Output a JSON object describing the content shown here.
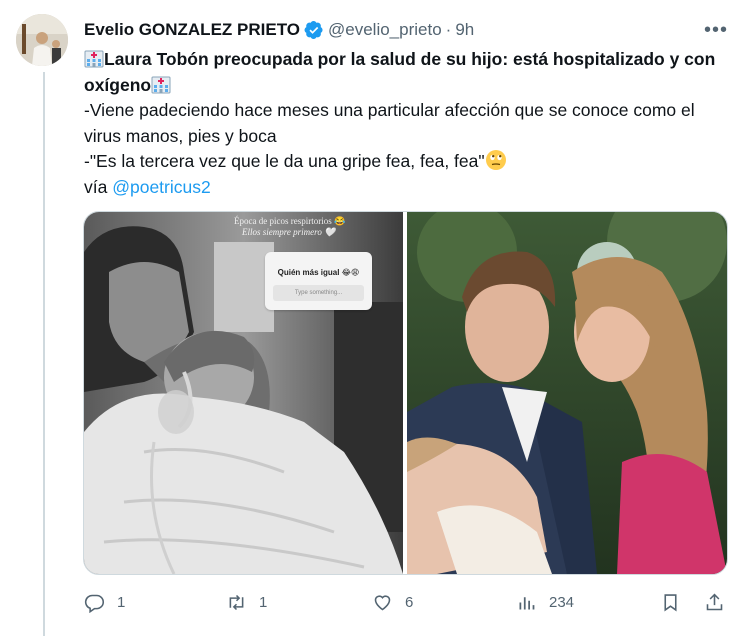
{
  "tweet": {
    "author_name": "Evelio GONZALEZ PRIETO",
    "handle": "@evelio_prieto",
    "separator": "·",
    "time": "9h",
    "more_label": "•••",
    "headline": "Laura Tobón preocupada por la salud de su hijo: está hospitalizado y con oxígeno",
    "line1": "-Viene padeciendo hace meses una particular afección que se conoce como el virus manos, pies y boca",
    "line2": "-\"Es la tercera vez que le da una gripe fea, fea, fea\"",
    "via_prefix": "vía ",
    "via_link": "@poetricus2",
    "story_caption_1": "Época de picos respirtorios 😂",
    "story_caption_2": "Ellos siempre primero 🤍",
    "story_question": "Quién más igual 😂😩",
    "story_input_placeholder": "Type something...",
    "icons": {
      "verified": "verified-badge-icon",
      "hospital": "hospital-emoji-icon",
      "face": "eye-roll-emoji-icon"
    },
    "colors": {
      "accent": "#1d9bf0",
      "muted": "#536471",
      "text": "#0f1419"
    }
  },
  "actions": {
    "replies": "1",
    "retweets": "1",
    "likes": "6",
    "views": "234"
  }
}
